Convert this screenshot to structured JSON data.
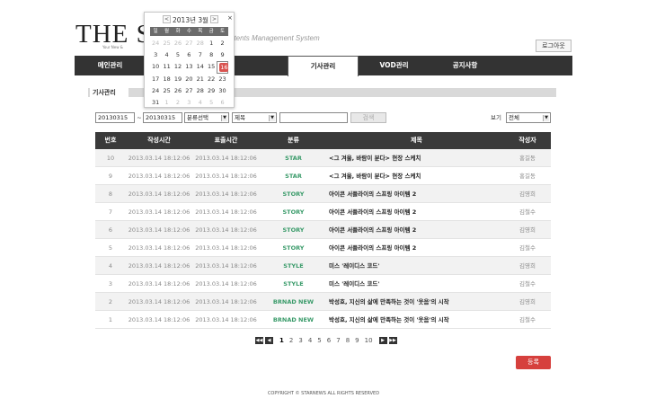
{
  "header": {
    "logo": "THE ST",
    "logo_sub": "Your New & ",
    "cms_title": "ntents Management System",
    "logout": "로그아웃"
  },
  "nav": {
    "items": [
      {
        "label": "메인관리"
      },
      {
        "label": ""
      },
      {
        "label": ""
      },
      {
        "label": "기사관리"
      },
      {
        "label": "VOD관리"
      },
      {
        "label": "공지사항"
      },
      {
        "label": ""
      }
    ]
  },
  "breadcrumb": "기사관리",
  "search": {
    "date_from": "20130315",
    "separator": "~",
    "date_to": "20130315",
    "category_select": "분류선택",
    "field_select": "제목",
    "keyword": "",
    "search_button": "검색",
    "view_label": "보기",
    "view_select": "전체"
  },
  "table": {
    "headers": [
      "번호",
      "작성시간",
      "표출시간",
      "분류",
      "제목",
      "작성자"
    ],
    "rows": [
      {
        "no": "10",
        "created": "2013.03.14 18:12:06",
        "shown": "2013.03.14 18:12:06",
        "category": "STAR",
        "title": "<그 겨울, 바람이 분다> 현장 스케치",
        "author": "홍길동"
      },
      {
        "no": "9",
        "created": "2013.03.14 18:12:06",
        "shown": "2013.03.14 18:12:06",
        "category": "STAR",
        "title": "<그 겨울, 바람이 분다> 현장 스케치",
        "author": "홍길동"
      },
      {
        "no": "8",
        "created": "2013.03.14 18:12:06",
        "shown": "2013.03.14 18:12:06",
        "category": "STORY",
        "title": "아이콘 서플라이의 스프링 아이템 2",
        "author": "김영희"
      },
      {
        "no": "7",
        "created": "2013.03.14 18:12:06",
        "shown": "2013.03.14 18:12:06",
        "category": "STORY",
        "title": "아이콘 서플라이의 스프링 아이템 2",
        "author": "김철수"
      },
      {
        "no": "6",
        "created": "2013.03.14 18:12:06",
        "shown": "2013.03.14 18:12:06",
        "category": "STORY",
        "title": "아이콘 서플라이의 스프링 아이템 2",
        "author": "김영희"
      },
      {
        "no": "5",
        "created": "2013.03.14 18:12:06",
        "shown": "2013.03.14 18:12:06",
        "category": "STORY",
        "title": "아이콘 서플라이의 스프링 아이템 2",
        "author": "김철수"
      },
      {
        "no": "4",
        "created": "2013.03.14 18:12:06",
        "shown": "2013.03.14 18:12:06",
        "category": "STYLE",
        "title": "미스 '레이디스 코드'",
        "author": "김영희"
      },
      {
        "no": "3",
        "created": "2013.03.14 18:12:06",
        "shown": "2013.03.14 18:12:06",
        "category": "STYLE",
        "title": "미스 '레이디스 코드'",
        "author": "김철수"
      },
      {
        "no": "2",
        "created": "2013.03.14 18:12:06",
        "shown": "2013.03.14 18:12:06",
        "category": "BRNAD NEW",
        "title": "박성호, 지신의 삶에 만족하는 것이 '웃음'의 시작",
        "author": "김영희"
      },
      {
        "no": "1",
        "created": "2013.03.14 18:12:06",
        "shown": "2013.03.14 18:12:06",
        "category": "BRNAD NEW",
        "title": "박성호, 지신의 삶에 만족하는 것이 '웃음'의 시작",
        "author": "김철수"
      }
    ]
  },
  "pager": {
    "first": "◀◀",
    "prev": "◀",
    "pages": [
      "1",
      "2",
      "3",
      "4",
      "5",
      "6",
      "7",
      "8",
      "9",
      "10"
    ],
    "current": "1",
    "next": "▶",
    "last": "▶▶"
  },
  "register_button": "등록",
  "footer": "COPYRIGHT © STARNEWS ALL RIGHTS RESERVED",
  "calendar": {
    "prev": "<",
    "next": ">",
    "title": "2013년 3월",
    "close": "×",
    "dow": [
      "일",
      "월",
      "화",
      "수",
      "목",
      "금",
      "토"
    ],
    "selected": "16",
    "weeks": [
      [
        {
          "d": "24",
          "o": true
        },
        {
          "d": "25",
          "o": true
        },
        {
          "d": "26",
          "o": true
        },
        {
          "d": "27",
          "o": true
        },
        {
          "d": "28",
          "o": true
        },
        {
          "d": "1"
        },
        {
          "d": "2"
        }
      ],
      [
        {
          "d": "3"
        },
        {
          "d": "4"
        },
        {
          "d": "5"
        },
        {
          "d": "6"
        },
        {
          "d": "7"
        },
        {
          "d": "8"
        },
        {
          "d": "9"
        }
      ],
      [
        {
          "d": "10"
        },
        {
          "d": "11"
        },
        {
          "d": "12"
        },
        {
          "d": "13"
        },
        {
          "d": "14"
        },
        {
          "d": "15"
        },
        {
          "d": "16"
        }
      ],
      [
        {
          "d": "17"
        },
        {
          "d": "18"
        },
        {
          "d": "19"
        },
        {
          "d": "20"
        },
        {
          "d": "21"
        },
        {
          "d": "22"
        },
        {
          "d": "23"
        }
      ],
      [
        {
          "d": "24"
        },
        {
          "d": "25"
        },
        {
          "d": "26"
        },
        {
          "d": "27"
        },
        {
          "d": "28"
        },
        {
          "d": "29"
        },
        {
          "d": "30"
        }
      ],
      [
        {
          "d": "31"
        },
        {
          "d": "1",
          "o": true
        },
        {
          "d": "2",
          "o": true
        },
        {
          "d": "3",
          "o": true
        },
        {
          "d": "4",
          "o": true
        },
        {
          "d": "5",
          "o": true
        },
        {
          "d": "6",
          "o": true
        }
      ]
    ]
  },
  "colors": {
    "nav_bg": "#333333",
    "category": "#3a9b6a",
    "register": "#d6403d",
    "selected_day": "#d9534f"
  }
}
